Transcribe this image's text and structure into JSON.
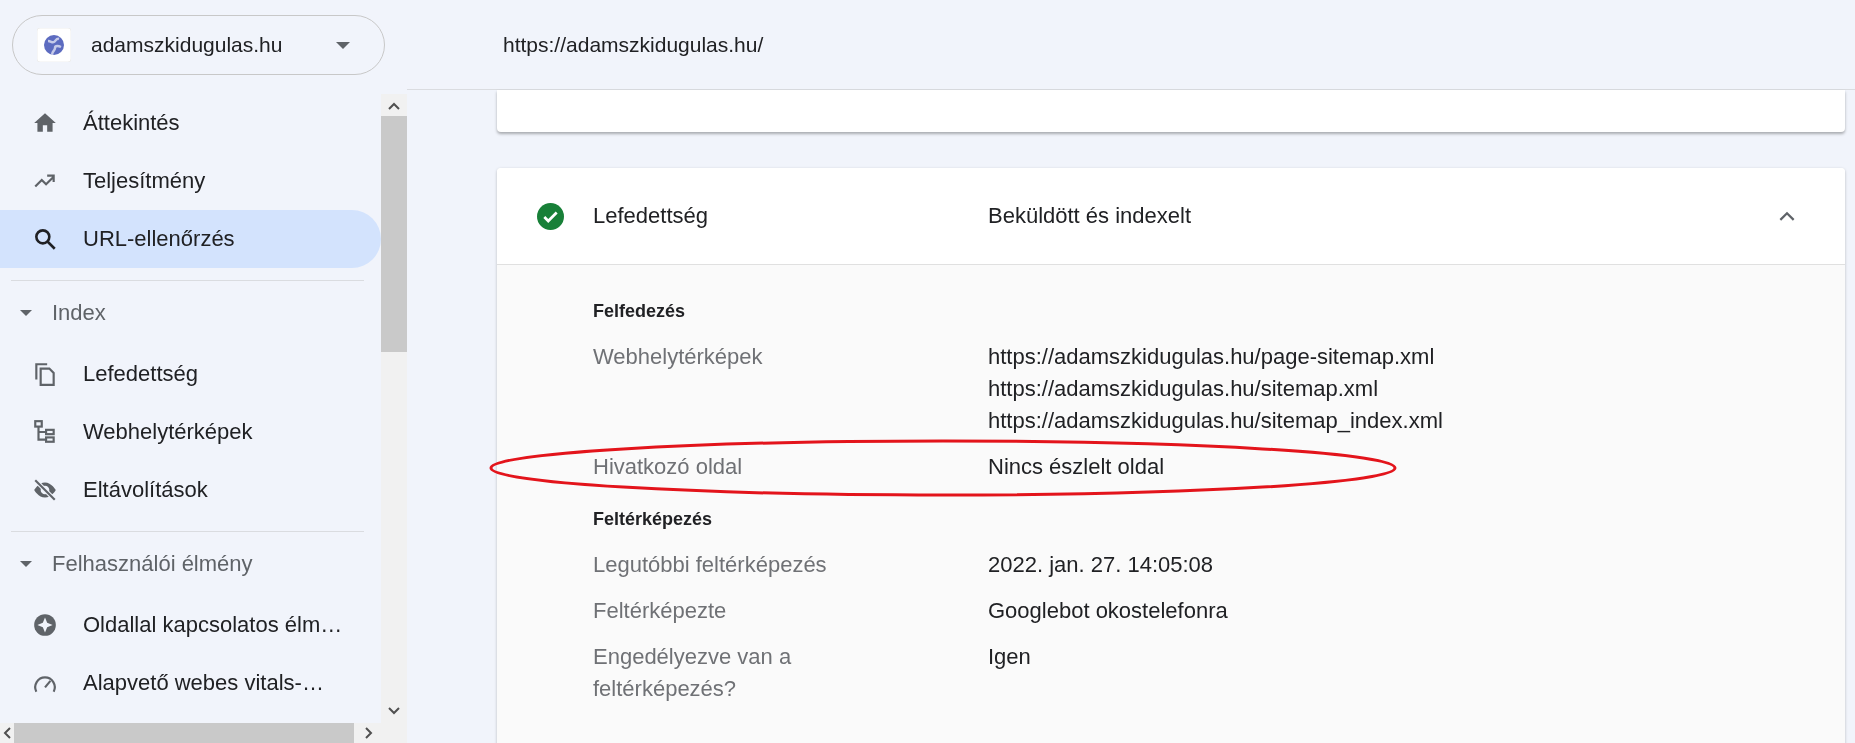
{
  "site_selector": {
    "name": "adamszkidugulas.hu"
  },
  "nav": [
    {
      "kind": "item",
      "label": "Áttekintés",
      "selected": false
    },
    {
      "kind": "item",
      "label": "Teljesítmény",
      "selected": false
    },
    {
      "kind": "item",
      "label": "URL-ellenőrzés",
      "selected": true
    },
    {
      "kind": "section",
      "label": "Index",
      "expanded": true
    },
    {
      "kind": "item",
      "label": "Lefedettség",
      "selected": false
    },
    {
      "kind": "item",
      "label": "Webhelytérképek",
      "selected": false
    },
    {
      "kind": "item",
      "label": "Eltávolítások",
      "selected": false
    },
    {
      "kind": "section",
      "label": "Felhasználói élmény",
      "expanded": true
    },
    {
      "kind": "item",
      "label": "Oldallal kapcsolatos élm…",
      "selected": false
    },
    {
      "kind": "item",
      "label": "Alapvető webes vitals-…",
      "selected": false
    }
  ],
  "url_bar": {
    "url": "https://adamszkidugulas.hu/"
  },
  "coverage": {
    "title": "Lefedettség",
    "status": "Beküldött és indexelt",
    "ok": true,
    "expanded": true,
    "sections": [
      {
        "heading": "Felfedezés",
        "rows": [
          {
            "label": "Webhelytérképek",
            "values": [
              "https://adamszkidugulas.hu/page-sitemap.xml",
              "https://adamszkidugulas.hu/sitemap.xml",
              "https://adamszkidugulas.hu/sitemap_index.xml"
            ]
          },
          {
            "label": "Hivatkozó oldal",
            "values": [
              "Nincs észlelt oldal"
            ],
            "highlighted": true
          }
        ]
      },
      {
        "heading": "Feltérképezés",
        "rows": [
          {
            "label": "Legutóbbi feltérképezés",
            "values": [
              "2022. jan. 27. 14:05:08"
            ]
          },
          {
            "label": "Feltérképezte",
            "values": [
              "Googlebot okostelefonra"
            ]
          },
          {
            "label": "Engedélyezve van a feltérképezés?",
            "values": [
              "Igen"
            ]
          }
        ]
      }
    ]
  }
}
